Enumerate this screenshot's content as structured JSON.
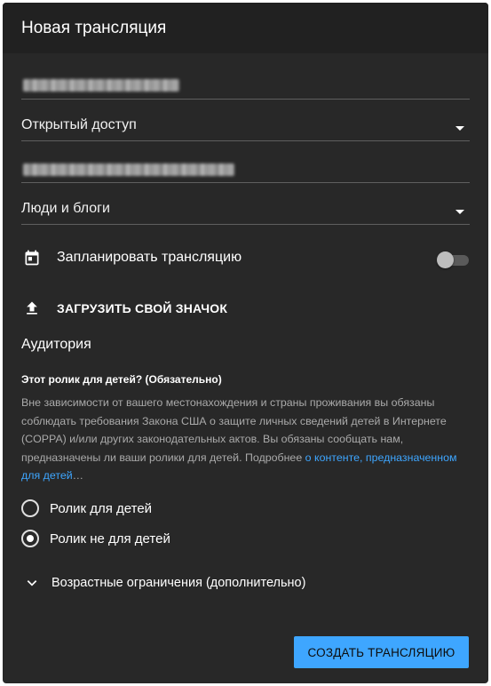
{
  "dialog": {
    "title": "Новая трансляция"
  },
  "privacy": {
    "selected": "Открытый доступ"
  },
  "category": {
    "selected": "Люди и блоги"
  },
  "schedule": {
    "label": "Запланировать трансляцию",
    "enabled": false
  },
  "thumbnail": {
    "upload_label": "ЗАГРУЗИТЬ СВОЙ ЗНАЧОК"
  },
  "audience": {
    "title": "Аудитория",
    "question": "Этот ролик для детей? (Обязательно)",
    "description": "Вне зависимости от вашего местонахождения и страны проживания вы обязаны соблюдать требования Закона США о защите личных сведений детей в Интернете (COPPA) и/или других законодательных актов. Вы обязаны сообщать нам, предназначены ли ваши ролики для детей. Подробнее ",
    "link_text": "о контенте, предназначенном для детей",
    "ellipsis": "…",
    "options": [
      {
        "label": "Ролик для детей",
        "checked": false
      },
      {
        "label": "Ролик не для детей",
        "checked": true
      }
    ]
  },
  "age_restrictions": {
    "label": "Возрастные ограничения (дополнительно)"
  },
  "footer": {
    "create_label": "СОЗДАТЬ ТРАНСЛЯЦИЮ"
  },
  "colors": {
    "accent": "#3ea6ff",
    "background": "#282828",
    "header": "#212121"
  }
}
